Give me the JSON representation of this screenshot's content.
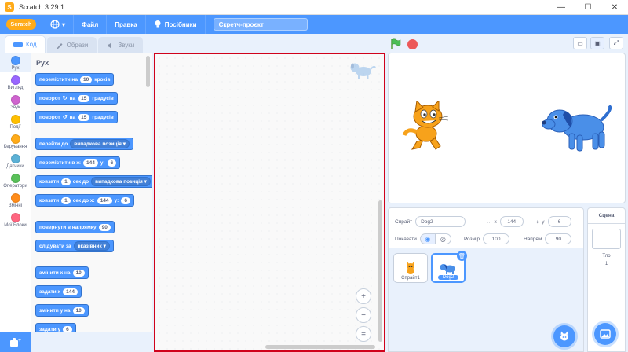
{
  "window": {
    "title": "Scratch 3.29.1",
    "controls": [
      "—",
      "☐",
      "✕"
    ]
  },
  "menubar": {
    "logo_text": "Scratch",
    "globe_caret": "▾",
    "items": [
      "Файл",
      "Правка"
    ],
    "tutorials": "Посібники",
    "project_title": "Скретч-проєкт"
  },
  "tabs": [
    {
      "label": "Код",
      "icon": "code-icon"
    },
    {
      "label": "Образи",
      "icon": "brush-icon"
    },
    {
      "label": "Звуки",
      "icon": "speaker-icon"
    }
  ],
  "categories": [
    {
      "label": "Рух",
      "color": "#4c97ff"
    },
    {
      "label": "Вигляд",
      "color": "#9966ff"
    },
    {
      "label": "Звук",
      "color": "#cf63cf"
    },
    {
      "label": "Події",
      "color": "#ffbf00"
    },
    {
      "label": "Керування",
      "color": "#ffab19"
    },
    {
      "label": "Датчики",
      "color": "#5cb1d6"
    },
    {
      "label": "Оператори",
      "color": "#59c059"
    },
    {
      "label": "Змінні",
      "color": "#ff8c1a"
    },
    {
      "label": "Мої Блоки",
      "color": "#ff6680"
    }
  ],
  "palette": {
    "heading": "Рух",
    "blocks": {
      "move": {
        "a": "перемістити на",
        "v": "10",
        "b": "кроків"
      },
      "turn_right": {
        "a": "поворот",
        "icon": "↻",
        "b": "на",
        "v": "15",
        "c": "градусів"
      },
      "turn_left": {
        "a": "поворот",
        "icon": "↺",
        "b": "на",
        "v": "15",
        "c": "градусів"
      },
      "goto": {
        "a": "перейти до",
        "dd": "випадкова позиція"
      },
      "goto_xy": {
        "a": "перемістити в x:",
        "x": "144",
        "b": "y:",
        "y": "6"
      },
      "glide_to": {
        "a": "ковзати",
        "v": "1",
        "b": "сек до",
        "dd": "випадкова позиція"
      },
      "glide_xy": {
        "a": "ковзати",
        "v": "1",
        "b": "сек до x:",
        "x": "144",
        "c": "y:",
        "y": "6"
      },
      "point_dir": {
        "a": "повернути в напрямку",
        "v": "90"
      },
      "point_towards": {
        "a": "слідувати за",
        "dd": "вказівник"
      },
      "change_x": {
        "a": "змінити x на",
        "v": "10"
      },
      "set_x": {
        "a": "задати x",
        "v": "144"
      },
      "change_y": {
        "a": "змінити у на",
        "v": "10"
      },
      "set_y": {
        "a": "задати у",
        "v": "6"
      }
    }
  },
  "script_area": {
    "zoom_in": "+",
    "zoom_out": "−",
    "zoom_reset": "="
  },
  "sprite_info": {
    "sprite_label": "Спрайт",
    "sprite_name": "Dog2",
    "x_label": "x",
    "x_value": "144",
    "y_label": "y",
    "y_value": "6",
    "show_label": "Показати",
    "size_label": "Розмір",
    "size_value": "100",
    "direction_label": "Напрям",
    "direction_value": "90"
  },
  "sprites": [
    {
      "name": "Спрайт1",
      "selected": false
    },
    {
      "name": "Dog2",
      "selected": true
    }
  ],
  "stage_target": {
    "heading": "Сцена",
    "backdrops_label": "Тло",
    "backdrops_count": "1"
  },
  "colors": {
    "accent": "#4c97ff",
    "highlight_border": "#d0021b"
  }
}
